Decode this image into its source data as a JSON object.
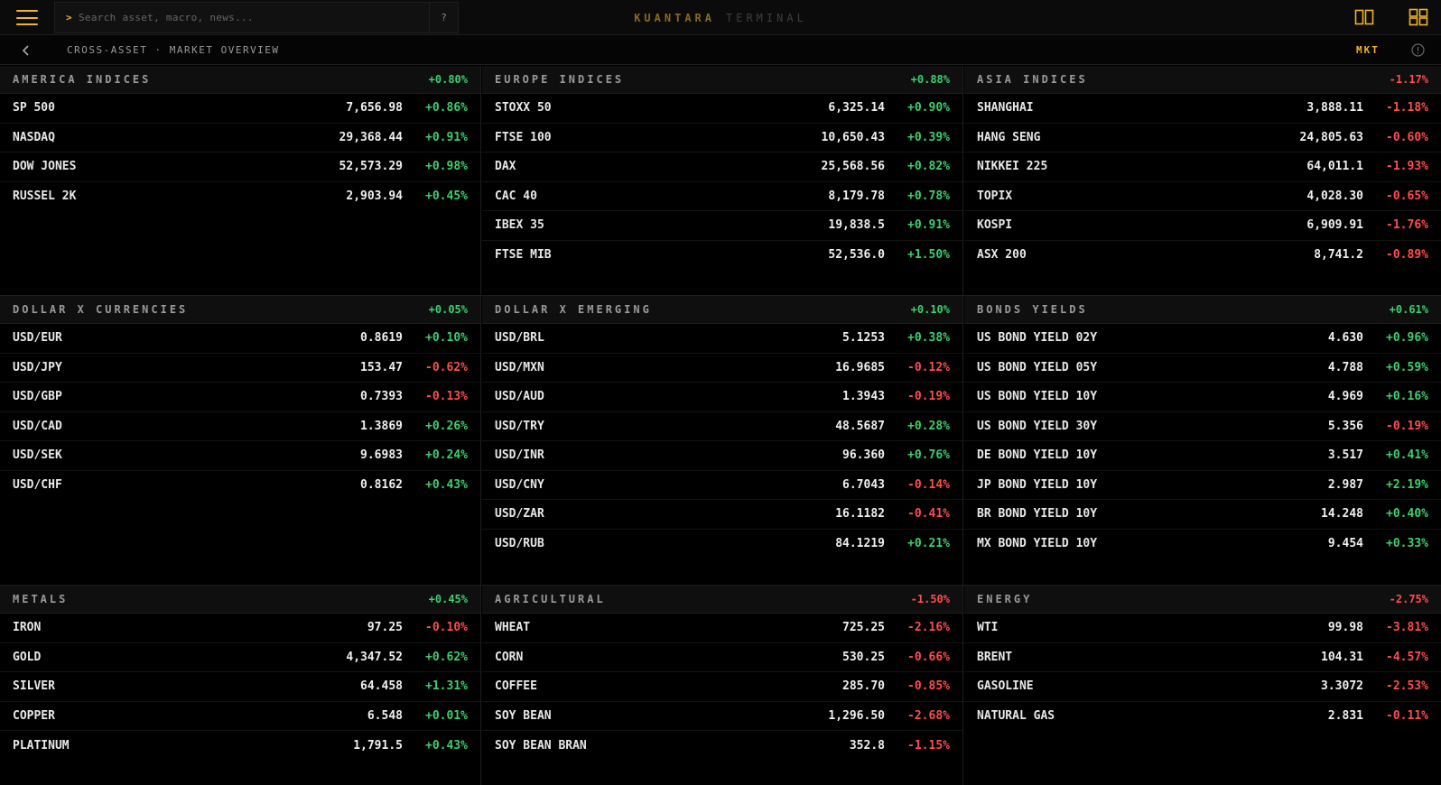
{
  "app": {
    "brand_primary": "KUANTARA",
    "brand_secondary": "TERMINAL",
    "search_prompt": ">",
    "search_placeholder": "Search asset, macro, news...",
    "help_label": "?",
    "breadcrumb": "CROSS-ASSET · MARKET OVERVIEW",
    "mode_badge": "MKT",
    "accent": "#f0b429",
    "positive_color": "#3ecf6e",
    "negative_color": "#ff4d4d",
    "icons": [
      "menu-icon",
      "split-view-icon",
      "grid-view-icon",
      "back-chevron-icon",
      "info-icon"
    ]
  },
  "panels": [
    {
      "id": "america-indices",
      "title": "AMERICA INDICES",
      "change": "+0.80%",
      "dir": "pos",
      "rows": [
        {
          "name": "SP 500",
          "price": "7,656.98",
          "change": "+0.86%",
          "dir": "pos"
        },
        {
          "name": "NASDAQ",
          "price": "29,368.44",
          "change": "+0.91%",
          "dir": "pos"
        },
        {
          "name": "DOW JONES",
          "price": "52,573.29",
          "change": "+0.98%",
          "dir": "pos"
        },
        {
          "name": "RUSSEL 2K",
          "price": "2,903.94",
          "change": "+0.45%",
          "dir": "pos"
        }
      ]
    },
    {
      "id": "europe-indices",
      "title": "EUROPE INDICES",
      "change": "+0.88%",
      "dir": "pos",
      "rows": [
        {
          "name": "STOXX 50",
          "price": "6,325.14",
          "change": "+0.90%",
          "dir": "pos"
        },
        {
          "name": "FTSE 100",
          "price": "10,650.43",
          "change": "+0.39%",
          "dir": "pos"
        },
        {
          "name": "DAX",
          "price": "25,568.56",
          "change": "+0.82%",
          "dir": "pos"
        },
        {
          "name": "CAC 40",
          "price": "8,179.78",
          "change": "+0.78%",
          "dir": "pos"
        },
        {
          "name": "IBEX 35",
          "price": "19,838.5",
          "change": "+0.91%",
          "dir": "pos"
        },
        {
          "name": "FTSE MIB",
          "price": "52,536.0",
          "change": "+1.50%",
          "dir": "pos"
        }
      ]
    },
    {
      "id": "asia-indices",
      "title": "ASIA INDICES",
      "change": "-1.17%",
      "dir": "neg",
      "rows": [
        {
          "name": "SHANGHAI",
          "price": "3,888.11",
          "change": "-1.18%",
          "dir": "neg"
        },
        {
          "name": "HANG SENG",
          "price": "24,805.63",
          "change": "-0.60%",
          "dir": "neg"
        },
        {
          "name": "NIKKEI 225",
          "price": "64,011.1",
          "change": "-1.93%",
          "dir": "neg"
        },
        {
          "name": "TOPIX",
          "price": "4,028.30",
          "change": "-0.65%",
          "dir": "neg"
        },
        {
          "name": "KOSPI",
          "price": "6,909.91",
          "change": "-1.76%",
          "dir": "neg"
        },
        {
          "name": "ASX 200",
          "price": "8,741.2",
          "change": "-0.89%",
          "dir": "neg"
        }
      ]
    },
    {
      "id": "dollar-x-currencies",
      "title": "DOLLAR X CURRENCIES",
      "change": "+0.05%",
      "dir": "pos",
      "rows": [
        {
          "name": "USD/EUR",
          "price": "0.8619",
          "change": "+0.10%",
          "dir": "pos"
        },
        {
          "name": "USD/JPY",
          "price": "153.47",
          "change": "-0.62%",
          "dir": "neg"
        },
        {
          "name": "USD/GBP",
          "price": "0.7393",
          "change": "-0.13%",
          "dir": "neg"
        },
        {
          "name": "USD/CAD",
          "price": "1.3869",
          "change": "+0.26%",
          "dir": "pos"
        },
        {
          "name": "USD/SEK",
          "price": "9.6983",
          "change": "+0.24%",
          "dir": "pos"
        },
        {
          "name": "USD/CHF",
          "price": "0.8162",
          "change": "+0.43%",
          "dir": "pos"
        }
      ]
    },
    {
      "id": "dollar-x-emerging",
      "title": "DOLLAR X EMERGING",
      "change": "+0.10%",
      "dir": "pos",
      "rows": [
        {
          "name": "USD/BRL",
          "price": "5.1253",
          "change": "+0.38%",
          "dir": "pos"
        },
        {
          "name": "USD/MXN",
          "price": "16.9685",
          "change": "-0.12%",
          "dir": "neg"
        },
        {
          "name": "USD/AUD",
          "price": "1.3943",
          "change": "-0.19%",
          "dir": "neg"
        },
        {
          "name": "USD/TRY",
          "price": "48.5687",
          "change": "+0.28%",
          "dir": "pos"
        },
        {
          "name": "USD/INR",
          "price": "96.360",
          "change": "+0.76%",
          "dir": "pos"
        },
        {
          "name": "USD/CNY",
          "price": "6.7043",
          "change": "-0.14%",
          "dir": "neg"
        },
        {
          "name": "USD/ZAR",
          "price": "16.1182",
          "change": "-0.41%",
          "dir": "neg"
        },
        {
          "name": "USD/RUB",
          "price": "84.1219",
          "change": "+0.21%",
          "dir": "pos"
        }
      ]
    },
    {
      "id": "bonds-yields",
      "title": "BONDS YIELDS",
      "change": "+0.61%",
      "dir": "pos",
      "rows": [
        {
          "name": "US BOND YIELD 02Y",
          "price": "4.630",
          "change": "+0.96%",
          "dir": "pos"
        },
        {
          "name": "US BOND YIELD 05Y",
          "price": "4.788",
          "change": "+0.59%",
          "dir": "pos"
        },
        {
          "name": "US BOND YIELD 10Y",
          "price": "4.969",
          "change": "+0.16%",
          "dir": "pos"
        },
        {
          "name": "US BOND YIELD 30Y",
          "price": "5.356",
          "change": "-0.19%",
          "dir": "neg"
        },
        {
          "name": "DE BOND YIELD 10Y",
          "price": "3.517",
          "change": "+0.41%",
          "dir": "pos"
        },
        {
          "name": "JP BOND YIELD 10Y",
          "price": "2.987",
          "change": "+2.19%",
          "dir": "pos"
        },
        {
          "name": "BR BOND YIELD 10Y",
          "price": "14.248",
          "change": "+0.40%",
          "dir": "pos"
        },
        {
          "name": "MX BOND YIELD 10Y",
          "price": "9.454",
          "change": "+0.33%",
          "dir": "pos"
        }
      ]
    },
    {
      "id": "metals",
      "title": "METALS",
      "change": "+0.45%",
      "dir": "pos",
      "rows": [
        {
          "name": "IRON",
          "price": "97.25",
          "change": "-0.10%",
          "dir": "neg"
        },
        {
          "name": "GOLD",
          "price": "4,347.52",
          "change": "+0.62%",
          "dir": "pos"
        },
        {
          "name": "SILVER",
          "price": "64.458",
          "change": "+1.31%",
          "dir": "pos"
        },
        {
          "name": "COPPER",
          "price": "6.548",
          "change": "+0.01%",
          "dir": "pos"
        },
        {
          "name": "PLATINUM",
          "price": "1,791.5",
          "change": "+0.43%",
          "dir": "pos"
        }
      ]
    },
    {
      "id": "agricultural",
      "title": "AGRICULTURAL",
      "change": "-1.50%",
      "dir": "neg",
      "rows": [
        {
          "name": "WHEAT",
          "price": "725.25",
          "change": "-2.16%",
          "dir": "neg"
        },
        {
          "name": "CORN",
          "price": "530.25",
          "change": "-0.66%",
          "dir": "neg"
        },
        {
          "name": "COFFEE",
          "price": "285.70",
          "change": "-0.85%",
          "dir": "neg"
        },
        {
          "name": "SOY BEAN",
          "price": "1,296.50",
          "change": "-2.68%",
          "dir": "neg"
        },
        {
          "name": "SOY BEAN BRAN",
          "price": "352.8",
          "change": "-1.15%",
          "dir": "neg"
        }
      ]
    },
    {
      "id": "energy",
      "title": "ENERGY",
      "change": "-2.75%",
      "dir": "neg",
      "rows": [
        {
          "name": "WTI",
          "price": "99.98",
          "change": "-3.81%",
          "dir": "neg"
        },
        {
          "name": "BRENT",
          "price": "104.31",
          "change": "-4.57%",
          "dir": "neg"
        },
        {
          "name": "GASOLINE",
          "price": "3.3072",
          "change": "-2.53%",
          "dir": "neg"
        },
        {
          "name": "NATURAL GAS",
          "price": "2.831",
          "change": "-0.11%",
          "dir": "neg"
        }
      ]
    }
  ]
}
